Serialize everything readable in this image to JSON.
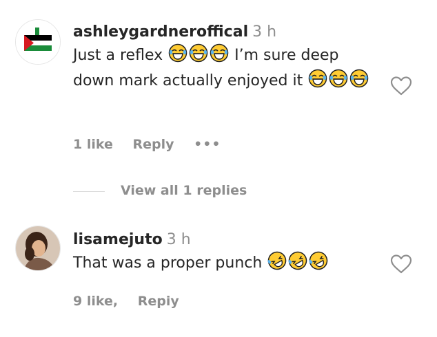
{
  "comments": [
    {
      "username": "ashleygardneroffical",
      "time": "3 h",
      "avatar_icon": "flag-avatar-icon",
      "text_parts": [
        "Just a reflex",
        "I’m sure deep down mark actually enjoyed it"
      ],
      "emoji_name": "face-with-tears-of-joy",
      "likes": "1 like",
      "reply": "Reply",
      "more": "•••"
    },
    {
      "username": "lisamejuto",
      "time": "3 h",
      "avatar_icon": "profile-photo-avatar-icon",
      "text": "That was a proper punch",
      "emoji_name": "rolling-on-floor-laughing",
      "likes": "9 like,",
      "reply": "Repiy"
    }
  ],
  "view_replies": "View all 1 replies",
  "colors": {
    "text": "#262626",
    "secondary": "#8e8e8e",
    "divider": "#dbdbdb",
    "emoji": "#ffcc33"
  }
}
